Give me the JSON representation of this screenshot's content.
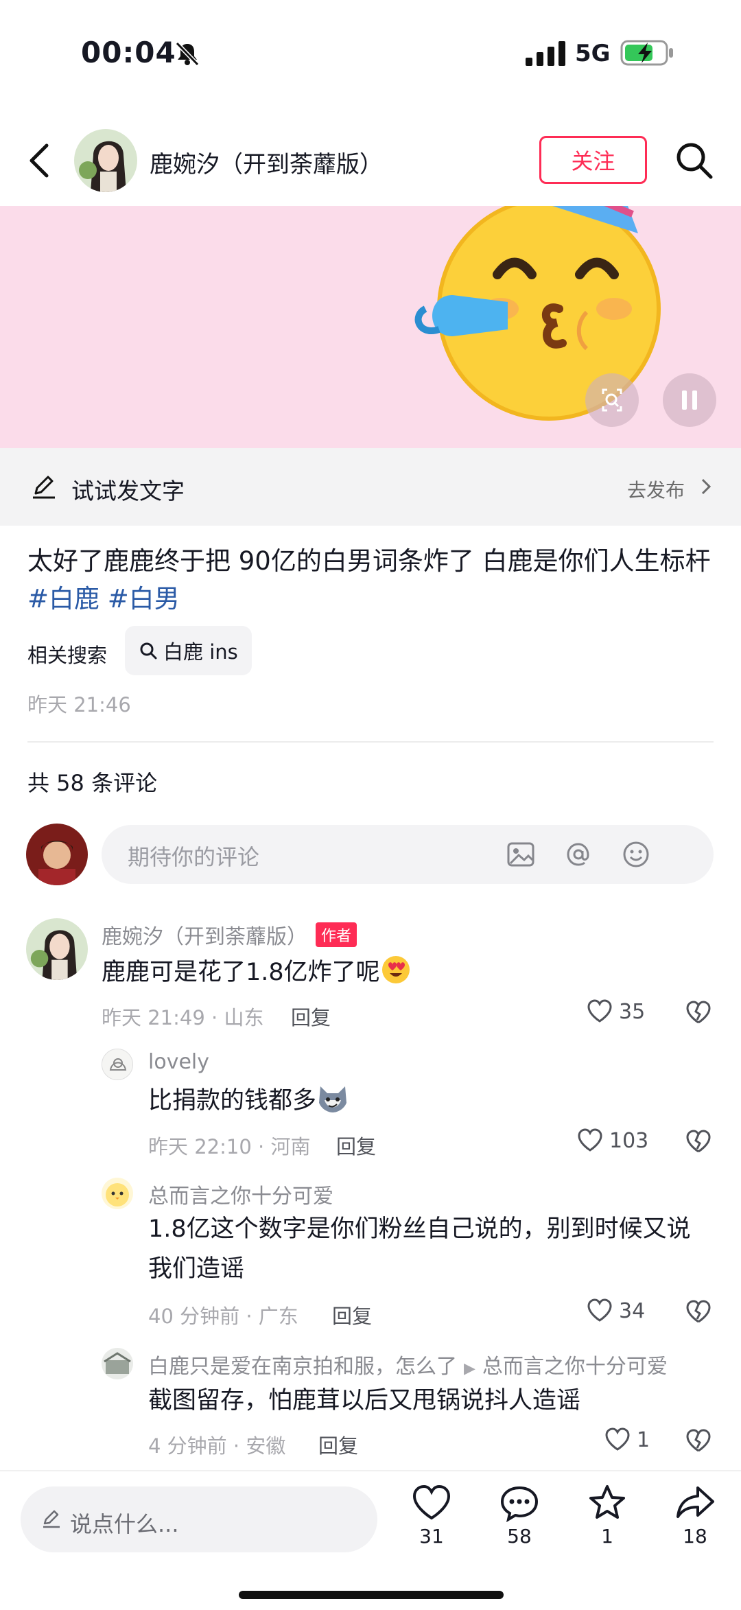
{
  "status_bar": {
    "time": "00:04",
    "network": "5G"
  },
  "header": {
    "author_name": "鹿婉汐（开到荼蘼版）",
    "follow_label": "关注"
  },
  "try_post": {
    "label": "试试发文字",
    "action": "去发布"
  },
  "post": {
    "caption": "太好了鹿鹿终于把 90亿的白男词条炸了 白鹿是你们人生标杆",
    "tags": [
      "#白鹿",
      "#白男"
    ],
    "related_label": "相关搜索",
    "related_query": "白鹿 ins",
    "time": "昨天 21:46"
  },
  "comments_header": {
    "count_text": "共 58 条评论"
  },
  "comment_input": {
    "placeholder": "期待你的评论"
  },
  "comments": [
    {
      "name": "鹿婉汐（开到荼蘼版）",
      "badge": "作者",
      "text": "鹿鹿可是花了1.8亿炸了呢",
      "meta": "昨天 21:49 · 山东",
      "reply": "回复",
      "likes": "35"
    },
    {
      "name": "lovely",
      "text": "比捐款的钱都多",
      "meta": "昨天 22:10 · 河南",
      "reply": "回复",
      "likes": "103"
    },
    {
      "name": "总而言之你十分可爱",
      "text_line1": "1.8亿这个数字是你们粉丝自己说的，别到时候又说",
      "text_line2": "我们造谣",
      "meta": "40 分钟前 · 广东",
      "reply": "回复",
      "likes": "34"
    },
    {
      "name": "白鹿只是爱在南京拍和服，怎么了",
      "reply_to": "总而言之你十分可爱",
      "text": "截图留存，怕鹿茸以后又甩锅说抖人造谣",
      "meta": "4 分钟前 · 安徽",
      "reply": "回复",
      "likes": "1"
    }
  ],
  "bottom_bar": {
    "placeholder": "说点什么...",
    "likes": "31",
    "comments": "58",
    "favorites": "1",
    "shares": "18"
  },
  "colors": {
    "accent": "#fe2c55",
    "tag": "#2a5aa6",
    "media_bg": "#fbdcea"
  }
}
